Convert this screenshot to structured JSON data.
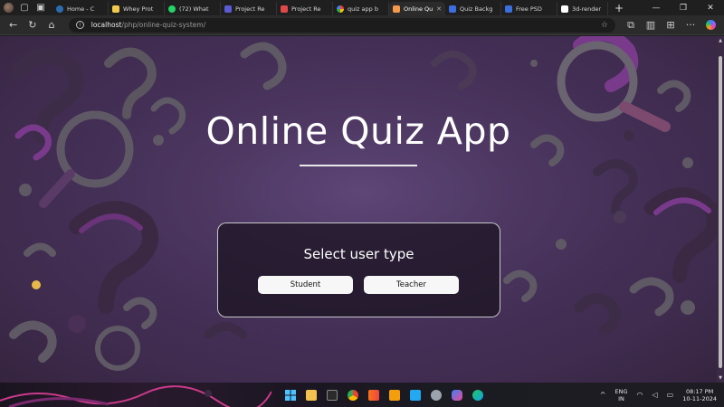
{
  "browser": {
    "tabs": [
      {
        "label": "Home - C",
        "favicon_color": "#2b6cb0"
      },
      {
        "label": "Whey Prot",
        "favicon_color": "#f2c94c"
      },
      {
        "label": "(72) What",
        "favicon_color": "#25d366"
      },
      {
        "label": "Project Re",
        "favicon_color": "#5b5bd6"
      },
      {
        "label": "Project Re",
        "favicon_color": "#e04848"
      },
      {
        "label": "quiz app b",
        "favicon_color": "#4285f4"
      },
      {
        "label": "Online Qu",
        "favicon_color": "#f2994a",
        "active": true
      },
      {
        "label": "Quiz Backg",
        "favicon_color": "#3b6fe0"
      },
      {
        "label": "Free PSD",
        "favicon_color": "#3b6fe0"
      },
      {
        "label": "3d-render",
        "favicon_color": "#ffffff"
      }
    ],
    "address": {
      "host": "localhost",
      "path": "/php/online-quiz-system/"
    }
  },
  "page": {
    "title": "Online Quiz App",
    "select_card": {
      "heading": "Select user type",
      "student_label": "Student",
      "teacher_label": "Teacher"
    }
  },
  "taskbar": {
    "lang_line1": "ENG",
    "lang_line2": "IN",
    "time": "08:17 PM",
    "date": "10-11-2024"
  },
  "colors": {
    "page_bg": "#4a345f",
    "card_bg": "#19121e",
    "button_bg": "#f7f7f7",
    "accent_purple": "#7a3a8c"
  }
}
